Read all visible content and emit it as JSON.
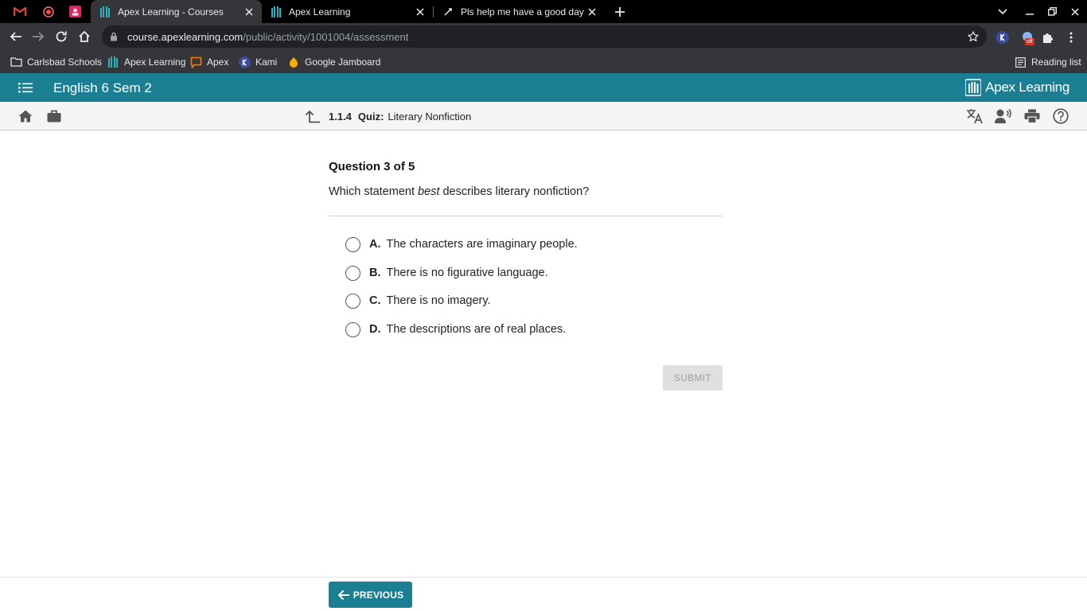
{
  "browser": {
    "tabs": [
      {
        "title": "Apex Learning - Courses",
        "active": true,
        "icon": "apex-icon"
      },
      {
        "title": "Apex Learning",
        "active": false,
        "icon": "apex-icon"
      },
      {
        "title": "Pls help me have a good day th...",
        "active": false,
        "icon": "brainly-icon"
      }
    ],
    "pinned_tabs": [
      "gmail-icon",
      "record-icon",
      "classroom-icon"
    ],
    "url": {
      "host": "course.apexlearning.com",
      "path": "/public/activity/1001004/assessment"
    },
    "extension_badge": "off",
    "bookmarks": [
      {
        "label": "Carlsbad Schools",
        "icon": "folder-icon"
      },
      {
        "label": "Apex Learning",
        "icon": "apex-icon"
      },
      {
        "label": "Apex",
        "icon": "chat-icon"
      },
      {
        "label": "Kami",
        "icon": "kami-icon"
      },
      {
        "label": "Google Jamboard",
        "icon": "jamboard-icon"
      }
    ],
    "reading_list": "Reading list",
    "colors": {
      "tabstrip": "#000000",
      "toolbar": "#35363a"
    }
  },
  "app": {
    "course_title": "English 6 Sem 2",
    "brand": "Apex Learning",
    "colors": {
      "accent": "#1a7f93"
    }
  },
  "breadcrumb": {
    "number": "1.1.4",
    "kind": "Quiz:",
    "title": "Literary Nonfiction"
  },
  "question": {
    "header": "Question 3 of 5",
    "text_before": "Which statement ",
    "text_emphasis": "best",
    "text_after": " describes literary nonfiction?",
    "choices": [
      {
        "letter": "A.",
        "text": "The characters are imaginary people."
      },
      {
        "letter": "B.",
        "text": "There is no figurative language."
      },
      {
        "letter": "C.",
        "text": "There is no imagery."
      },
      {
        "letter": "D.",
        "text": "The descriptions are of real places."
      }
    ],
    "submit_label": "SUBMIT"
  },
  "footer": {
    "previous_label": "PREVIOUS"
  }
}
